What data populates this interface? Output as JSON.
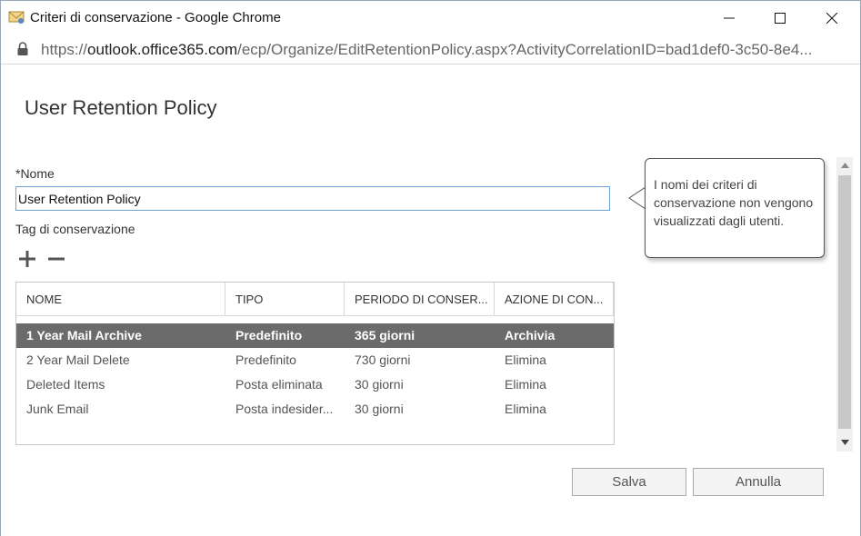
{
  "window": {
    "title": "Criteri di conservazione - Google Chrome",
    "icon": "mail-envelope-icon"
  },
  "address_bar": {
    "url_prefix": "https://",
    "url_host": "outlook.office365.com",
    "url_path": "/ecp/Organize/EditRetentionPolicy.aspx?ActivityCorrelationID=bad1def0-3c50-8e4..."
  },
  "dialog": {
    "title": "User Retention Policy",
    "name_label": "*Nome",
    "name_value": "User Retention Policy",
    "tags_label": "Tag di conservazione",
    "tooltip": "I nomi dei criteri di conservazione non vengono visualizzati dagli utenti."
  },
  "table": {
    "columns": [
      "NOME",
      "TIPO",
      "PERIODO DI CONSER...",
      "AZIONE DI CON..."
    ],
    "rows": [
      [
        "1 Year Mail Archive",
        "Predefinito",
        "365 giorni",
        "Archivia"
      ],
      [
        "2 Year Mail Delete",
        "Predefinito",
        "730 giorni",
        "Elimina"
      ],
      [
        "Deleted Items",
        "Posta eliminata",
        "30 giorni",
        "Elimina"
      ],
      [
        "Junk Email",
        "Posta indesider...",
        "30 giorni",
        "Elimina"
      ]
    ],
    "selected_row": 0
  },
  "buttons": {
    "save": "Salva",
    "cancel": "Annulla"
  },
  "colors": {
    "selected_row_bg": "#6b6b6b",
    "input_border": "#6fa3d6"
  }
}
